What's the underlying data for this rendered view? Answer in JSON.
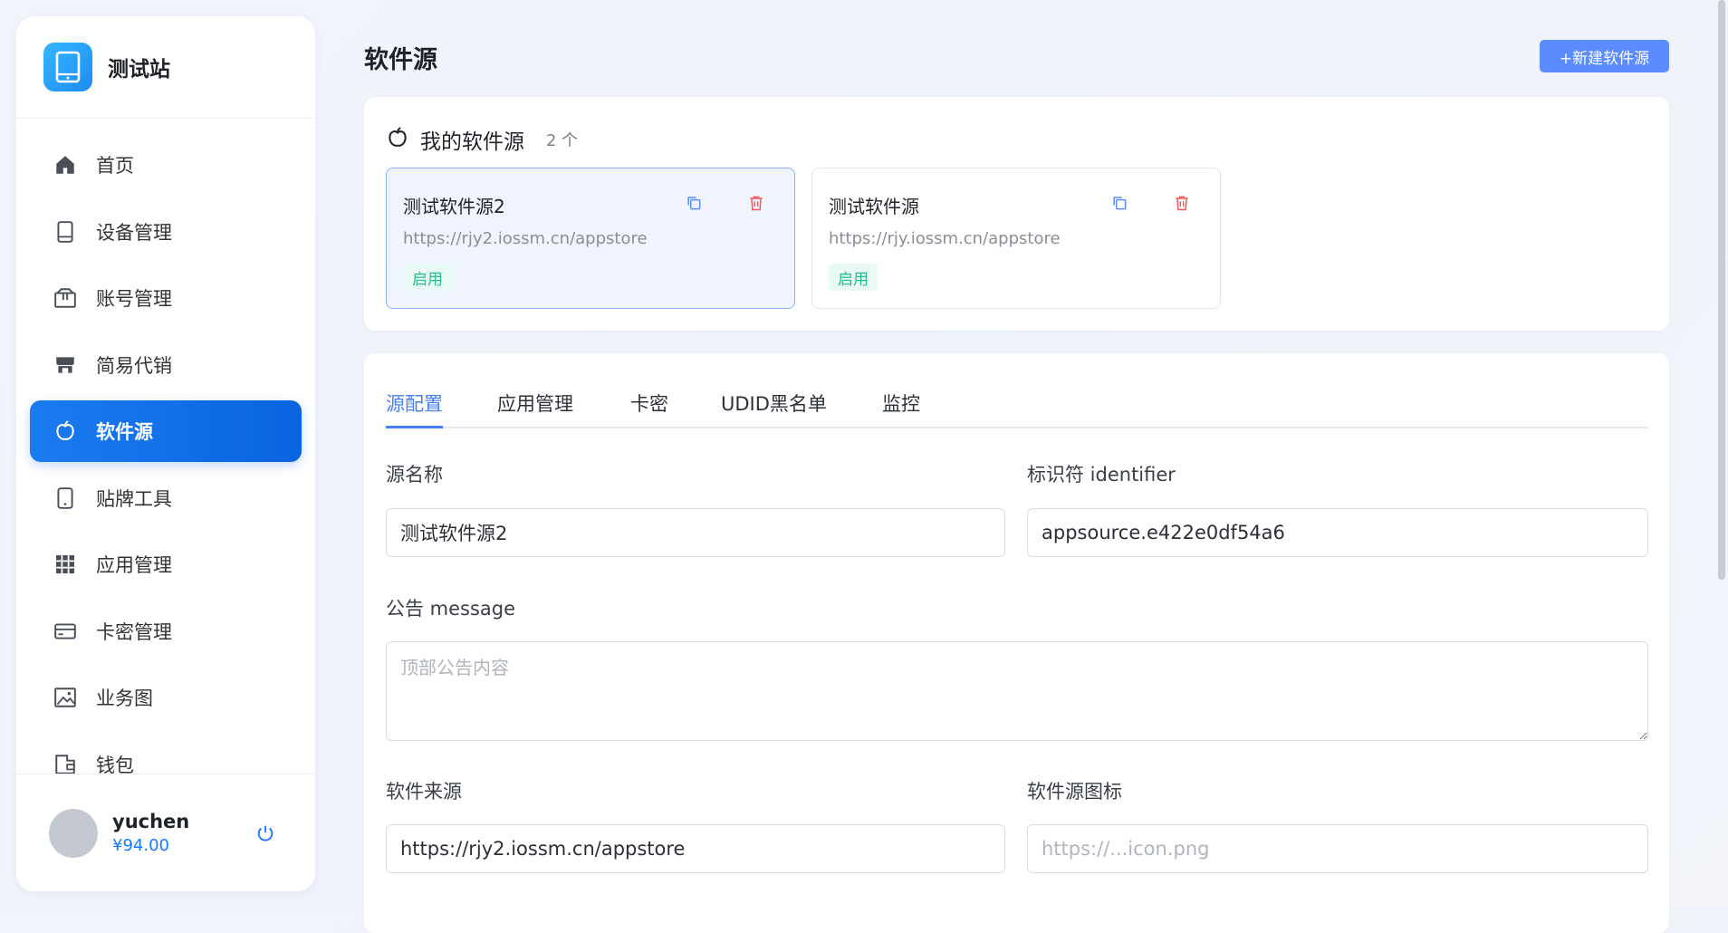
{
  "brand": {
    "title": "测试站"
  },
  "sidebar": {
    "items": [
      {
        "label": "首页",
        "icon": "home-icon"
      },
      {
        "label": "设备管理",
        "icon": "tablet-icon"
      },
      {
        "label": "账号管理",
        "icon": "package-icon"
      },
      {
        "label": "简易代销",
        "icon": "store-icon"
      },
      {
        "label": "软件源",
        "icon": "apple-icon"
      },
      {
        "label": "贴牌工具",
        "icon": "phone-icon"
      },
      {
        "label": "应用管理",
        "icon": "grid-icon"
      },
      {
        "label": "卡密管理",
        "icon": "card-icon"
      },
      {
        "label": "业务图",
        "icon": "image-icon"
      },
      {
        "label": "钱包",
        "icon": "wallet-icon"
      }
    ],
    "active_index": 4
  },
  "user": {
    "name": "yuchen",
    "balance": "¥94.00"
  },
  "header": {
    "title": "软件源",
    "new_button": "+新建软件源"
  },
  "sources": {
    "title": "我的软件源",
    "count": "2 个",
    "items": [
      {
        "name": "测试软件源2",
        "url": "https://rjy2.iossm.cn/appstore",
        "status": "启用"
      },
      {
        "name": "测试软件源",
        "url": "https://rjy.iossm.cn/appstore",
        "status": "启用"
      }
    ]
  },
  "tabs": [
    "源配置",
    "应用管理",
    "卡密",
    "UDID黑名单",
    "监控"
  ],
  "form": {
    "name_label": "源名称",
    "name_value": "测试软件源2",
    "identifier_label": "标识符 identifier",
    "identifier_value": "appsource.e422e0df54a6",
    "message_label": "公告 message",
    "message_placeholder": "顶部公告内容",
    "source_label": "软件来源",
    "source_value": "https://rjy2.iossm.cn/appstore",
    "icon_label": "软件源图标",
    "icon_placeholder": "https://...icon.png"
  },
  "colors": {
    "accent": "#1677ff",
    "tab_active": "#4a7ef5",
    "tag_green": "#25c08a",
    "delete_red": "#f05a5a"
  }
}
